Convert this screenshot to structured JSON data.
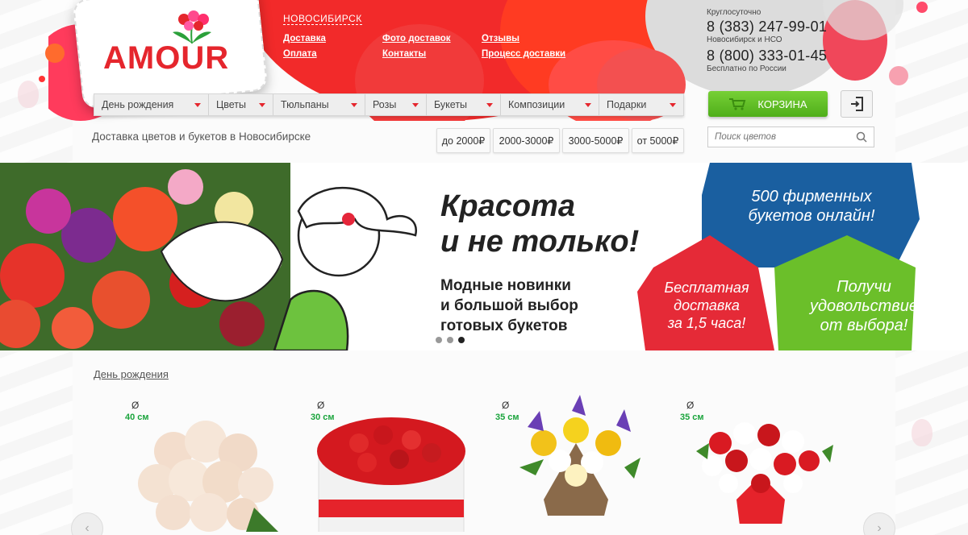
{
  "logo": {
    "text": "AMOUR"
  },
  "header": {
    "city": "НОВОСИБИРСК",
    "links": [
      "Доставка",
      "Фото доставок",
      "Отзывы",
      "Оплата",
      "Контакты",
      "Процесс доставки"
    ]
  },
  "contacts": {
    "hours": "Круглосуточно",
    "phone1": "8 (383) 247-99-01",
    "phone1_note": "Новосибирск и НСО",
    "phone2": "8 (800) 333-01-45",
    "phone2_note": "Бесплатно по России"
  },
  "menu": [
    "День рождения",
    "Цветы",
    "Тюльпаны",
    "Розы",
    "Букеты",
    "Композиции",
    "Подарки"
  ],
  "cart": {
    "label": "КОРЗИНА"
  },
  "tagline": "Доставка цветов и букетов в Новосибирске",
  "price_filters": [
    "до 2000₽",
    "2000-3000₽",
    "3000-5000₽",
    "от 5000₽"
  ],
  "search": {
    "placeholder": "Поиск цветов"
  },
  "banner": {
    "headline_line1": "Красота",
    "headline_line2": "и не только!",
    "sub_line1": "Модные новинки",
    "sub_line2": "и большой выбор",
    "sub_line3": "готовых букетов",
    "blue_badge_line1": "500 фирменных",
    "blue_badge_line2": "букетов онлайн!",
    "red_badge_line1": "Бесплатная",
    "red_badge_line2": "доставка",
    "red_badge_line3": "за 1,5 часа!",
    "green_badge_line1": "Получи",
    "green_badge_line2": "удовольствие",
    "green_badge_line3": "от выбора!",
    "slide_count": 3,
    "active_slide": 3
  },
  "section": {
    "title": "День рождения"
  },
  "products": [
    {
      "diameter_symbol": "Ø",
      "size": "40 см"
    },
    {
      "diameter_symbol": "Ø",
      "size": "30 см"
    },
    {
      "diameter_symbol": "Ø",
      "size": "35 см"
    },
    {
      "diameter_symbol": "Ø",
      "size": "35 см"
    }
  ],
  "colors": {
    "brand_red": "#e5262d",
    "cart_green": "#5bbd22",
    "badge_blue": "#1a5fa0",
    "badge_red": "#e52a37",
    "badge_green": "#6bbf2a"
  }
}
